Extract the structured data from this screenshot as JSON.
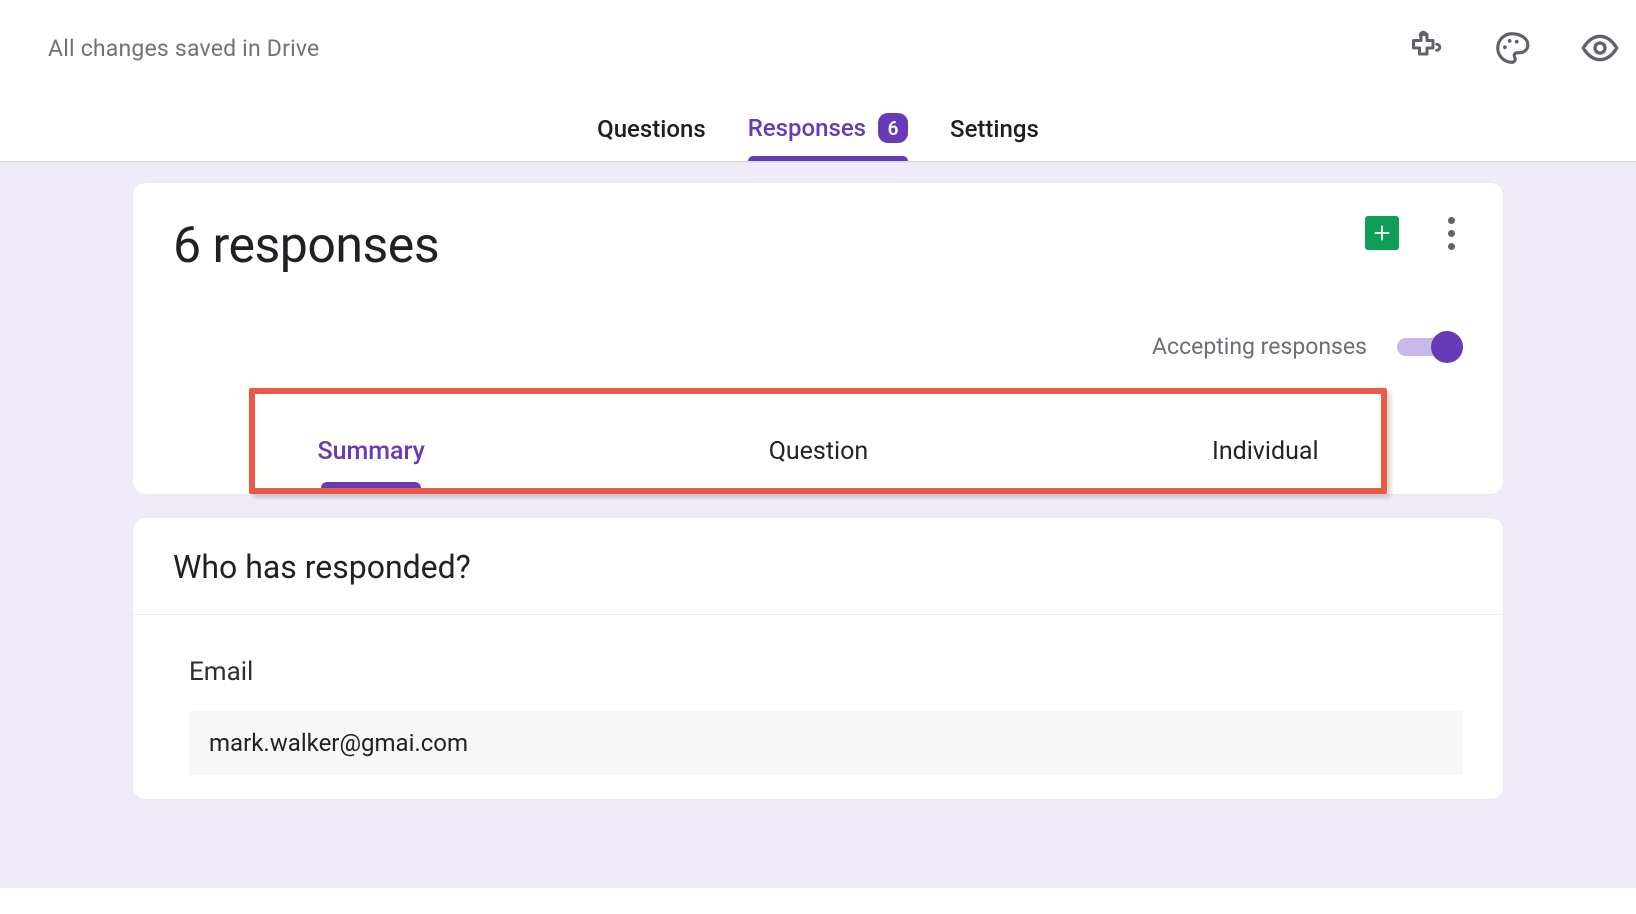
{
  "header": {
    "save_status": "All changes saved in Drive"
  },
  "main_tabs": {
    "questions": "Questions",
    "responses": "Responses",
    "responses_count": "6",
    "settings": "Settings"
  },
  "responses_panel": {
    "title": "6 responses",
    "accepting_label": "Accepting responses",
    "subtabs": {
      "summary": "Summary",
      "question": "Question",
      "individual": "Individual"
    }
  },
  "who_responded": {
    "title": "Who has responded?",
    "email_label": "Email",
    "emails": [
      "mark.walker@gmai.com"
    ]
  }
}
